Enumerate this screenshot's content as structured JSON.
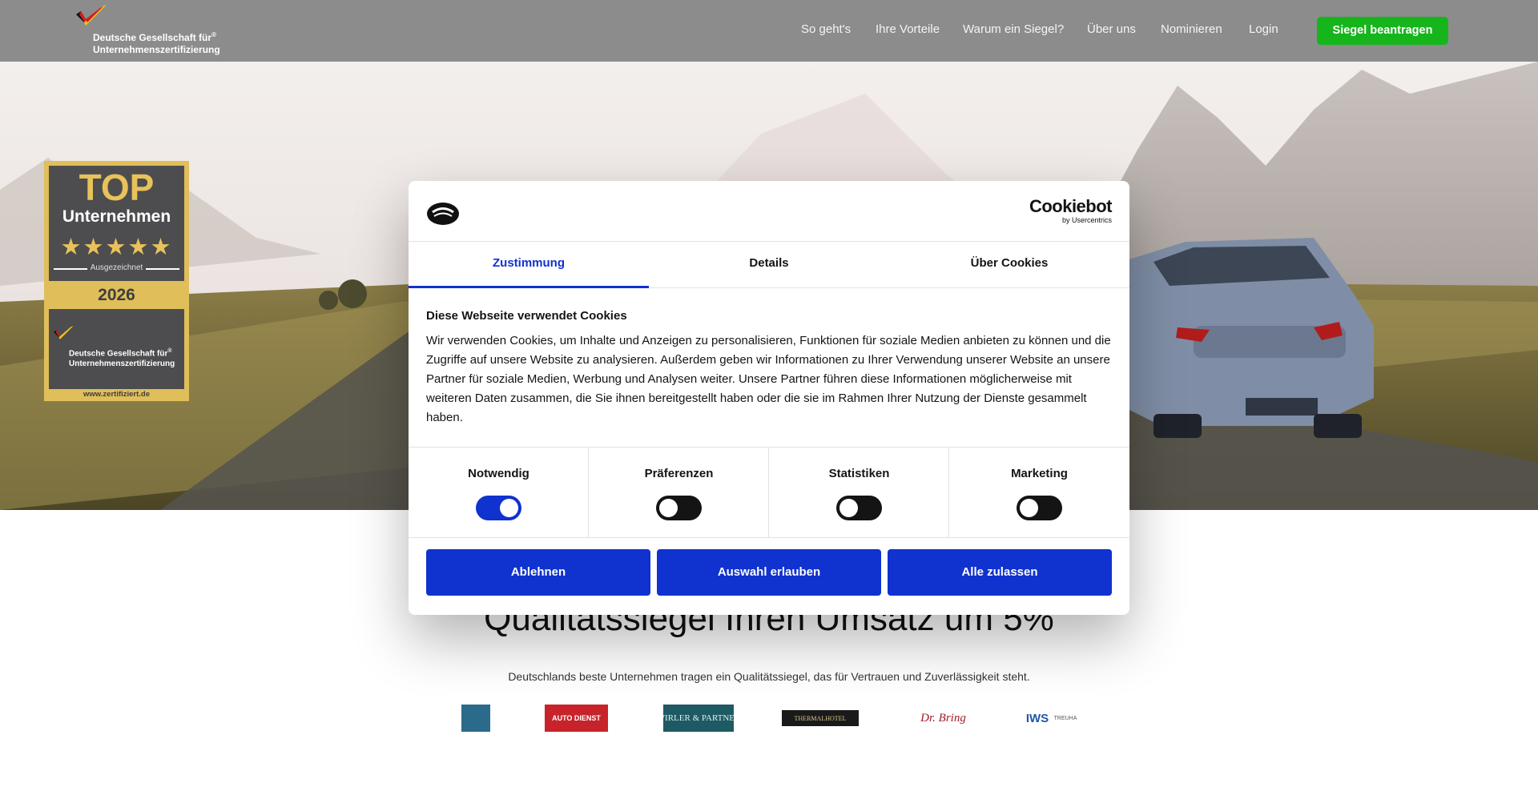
{
  "header": {
    "logo_text_line1": "Deutsche Gesellschaft für",
    "logo_reg": "®",
    "logo_text_line2": "Unternehmenszertifizierung",
    "nav": [
      "So geht's",
      "Ihre Vorteile",
      "Warum ein Siegel?",
      "Über uns",
      "Nominieren",
      "Login"
    ],
    "cta_label": "Siegel beantragen",
    "cta_color": "#16b51b",
    "background_color": "#8c8c8c"
  },
  "badge": {
    "top": "TOP",
    "subtitle": "Unternehmen",
    "stars": 5,
    "stars_text": "★★★★★",
    "label": "Ausgezeichnet",
    "year": "2026",
    "org_line1": "Deutsche Gesellschaft für",
    "org_reg": "®",
    "org_line2": "Unternehmenszertifizierung",
    "url": "www.zertifiziert.de",
    "gold_color": "#e0be5a"
  },
  "page": {
    "headline": "Qualitätssiegel Ihren Umsatz um 5%",
    "subtitle": "Deutschlands beste Unternehmen tragen ein Qualitätssiegel,  das für Vertrauen und Zuverlässigkeit steht.",
    "partner_logos": [
      {
        "icon": "partner-emblem-icon",
        "text": ""
      },
      {
        "icon": "partner-autodienst-icon",
        "text": "AUTO DIENST"
      },
      {
        "icon": "partner-wirler-icon",
        "text": "WIRLER & PARTNER"
      },
      {
        "icon": "partner-thermalhotel-icon",
        "text": "THERMALHOTEL"
      },
      {
        "icon": "partner-drbring-icon",
        "text": "Dr. Bring"
      },
      {
        "icon": "partner-iws-icon",
        "text": "IWS"
      },
      {
        "icon": "partner-treuha-icon",
        "text": "TREUHA"
      }
    ]
  },
  "cookie": {
    "brand_name": "Cookiebot",
    "brand_by": "by Usercentrics",
    "tabs": [
      "Zustimmung",
      "Details",
      "Über Cookies"
    ],
    "active_tab": 0,
    "title": "Diese Webseite verwendet Cookies",
    "body": "Wir verwenden Cookies, um Inhalte und Anzeigen zu personalisieren, Funktionen für soziale Medien anbieten zu können und die Zugriffe auf unsere Website zu analysieren. Außerdem geben wir Informationen zu Ihrer Verwendung unserer Website an unsere Partner für soziale Medien, Werbung und Analysen weiter. Unsere Partner führen diese Informationen möglicherweise mit weiteren Daten zusammen, die Sie ihnen bereitgestellt haben oder die sie im Rahmen Ihrer Nutzung der Dienste gesammelt haben.",
    "toggles": [
      {
        "label": "Notwendig",
        "on": true
      },
      {
        "label": "Präferenzen",
        "on": false
      },
      {
        "label": "Statistiken",
        "on": false
      },
      {
        "label": "Marketing",
        "on": false
      }
    ],
    "buttons": [
      "Ablehnen",
      "Auswahl erlauben",
      "Alle zulassen"
    ],
    "accent_color": "#1032cf"
  }
}
